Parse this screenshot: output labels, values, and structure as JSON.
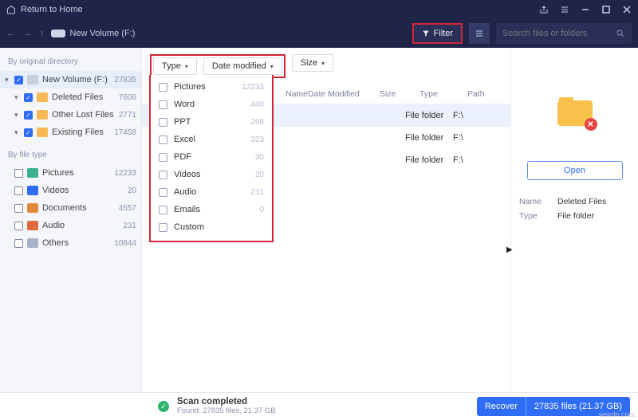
{
  "titlebar": {
    "return_label": "Return to Home"
  },
  "toolbar": {
    "volume_label": "New Volume (F:)",
    "filter_label": "Filter",
    "search_placeholder": "Search files or folders"
  },
  "sidebar": {
    "group1_label": "By original directory",
    "tree": [
      {
        "label": "New Volume (F:)",
        "count": "27835",
        "icon": "f-vol",
        "checked": true,
        "selected": true,
        "expand": true
      },
      {
        "label": "Deleted Files",
        "count": "7606",
        "icon": "f-del",
        "checked": true,
        "indent": true,
        "expand": true
      },
      {
        "label": "Other Lost Files",
        "count": "2771",
        "icon": "f-lost",
        "checked": true,
        "indent": true,
        "expand": true
      },
      {
        "label": "Existing Files",
        "count": "17458",
        "icon": "f-exist",
        "checked": true,
        "indent": true,
        "expand": true
      }
    ],
    "group2_label": "By file type",
    "types": [
      {
        "label": "Pictures",
        "count": "12233",
        "icon": "ft-pic"
      },
      {
        "label": "Videos",
        "count": "20",
        "icon": "ft-vid"
      },
      {
        "label": "Documents",
        "count": "4557",
        "icon": "ft-doc"
      },
      {
        "label": "Audio",
        "count": "231",
        "icon": "ft-aud"
      },
      {
        "label": "Others",
        "count": "10844",
        "icon": "ft-oth"
      }
    ]
  },
  "filterbar": {
    "type_label": "Type",
    "date_label": "Date modified",
    "size_label": "Size"
  },
  "type_dropdown": [
    {
      "label": "Pictures",
      "count": "12233"
    },
    {
      "label": "Word",
      "count": "440"
    },
    {
      "label": "PPT",
      "count": "268"
    },
    {
      "label": "Excel",
      "count": "323"
    },
    {
      "label": "PDF",
      "count": "30"
    },
    {
      "label": "Videos",
      "count": "20"
    },
    {
      "label": "Audio",
      "count": "231"
    },
    {
      "label": "Emails",
      "count": "0"
    },
    {
      "label": "Custom",
      "count": ""
    }
  ],
  "table": {
    "headers": {
      "name": "Name",
      "date": "Date Modified",
      "size": "Size",
      "type": "Type",
      "path": "Path"
    },
    "rows": [
      {
        "type": "File folder",
        "path": "F:\\",
        "selected": true
      },
      {
        "type": "File folder",
        "path": "F:\\"
      },
      {
        "type": "File folder",
        "path": "F:\\"
      }
    ]
  },
  "preview": {
    "open_label": "Open",
    "name_key": "Name",
    "name_val": "Deleted Files",
    "type_key": "Type",
    "type_val": "File folder"
  },
  "footer": {
    "title": "Scan completed",
    "sub": "Found: 27835 files, 21.37 GB",
    "recover_label": "Recover",
    "recover_count": "27835 files (21.37 GB)"
  },
  "watermark": "wsxdn.com"
}
